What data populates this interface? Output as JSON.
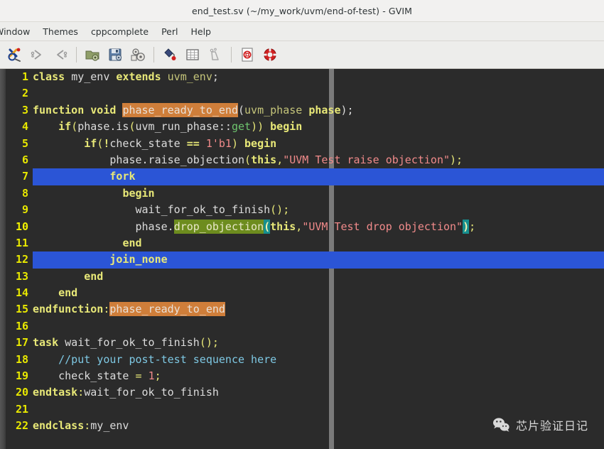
{
  "window": {
    "title": "end_test.sv (~/my_work/uvm/end-of-test) - GVIM"
  },
  "menubar": {
    "items": [
      {
        "label": "Window"
      },
      {
        "label": "Themes"
      },
      {
        "label": "cppcomplete"
      },
      {
        "label": "Perl"
      },
      {
        "label": "Help"
      }
    ]
  },
  "toolbar": {
    "buttons": [
      {
        "name": "gvim-logo-icon",
        "title": "GVim"
      },
      {
        "name": "redo-icon",
        "title": "Redo"
      },
      {
        "name": "undo-icon",
        "title": "Undo"
      },
      {
        "name": "open-folder-icon",
        "title": "Open"
      },
      {
        "name": "save-icon",
        "title": "Save"
      },
      {
        "name": "save-all-icon",
        "title": "Save All"
      },
      {
        "name": "paint-bucket-icon",
        "title": "Color"
      },
      {
        "name": "grid-table-icon",
        "title": "Table"
      },
      {
        "name": "tag-icon",
        "title": "Tags"
      },
      {
        "name": "help-page-icon",
        "title": "Help"
      },
      {
        "name": "lifebuoy-icon",
        "title": "Find Help"
      }
    ]
  },
  "editor": {
    "filename": "end_test.sv",
    "column_marker_column": 80,
    "colors": {
      "background": "#2b2b2b",
      "line_number": "#e8e800",
      "selection": "#2b55d6",
      "keyword": "#e8e878",
      "string": "#f08a8a",
      "comment": "#7ec8e3",
      "function": "#6ec46e",
      "match_highlight": "#cf7e3a",
      "search_highlight": "#6d8c1e",
      "paren_match": "#178f8f",
      "column_marker": "#7a7a7a"
    },
    "lines": [
      {
        "num": "1",
        "selected": false,
        "cursor": false,
        "tokens": [
          {
            "t": "class",
            "c": "kw"
          },
          {
            "t": " ",
            "c": "plain"
          },
          {
            "t": "my_env",
            "c": "id"
          },
          {
            "t": " ",
            "c": "plain"
          },
          {
            "t": "extends",
            "c": "kw"
          },
          {
            "t": " ",
            "c": "plain"
          },
          {
            "t": "uvm_env",
            "c": "typ"
          },
          {
            "t": ";",
            "c": "plain"
          }
        ]
      },
      {
        "num": "2",
        "selected": false,
        "cursor": false,
        "tokens": []
      },
      {
        "num": "3",
        "selected": false,
        "cursor": false,
        "tokens": [
          {
            "t": "function",
            "c": "kw"
          },
          {
            "t": " ",
            "c": "plain"
          },
          {
            "t": "void",
            "c": "kw"
          },
          {
            "t": " ",
            "c": "plain"
          },
          {
            "t": "phase_ready_to_end",
            "c": "hl-orange"
          },
          {
            "t": "(",
            "c": "plain"
          },
          {
            "t": "uvm_phase",
            "c": "typ"
          },
          {
            "t": " ",
            "c": "plain"
          },
          {
            "t": "phase",
            "c": "kw"
          },
          {
            "t": ");",
            "c": "plain"
          }
        ]
      },
      {
        "num": "4",
        "selected": false,
        "cursor": false,
        "tokens": [
          {
            "t": "    ",
            "c": "plain"
          },
          {
            "t": "if",
            "c": "kw"
          },
          {
            "t": "(",
            "c": "punct"
          },
          {
            "t": "phase.is",
            "c": "id"
          },
          {
            "t": "(",
            "c": "punct"
          },
          {
            "t": "uvm_run_phase::",
            "c": "id"
          },
          {
            "t": "get",
            "c": "fn"
          },
          {
            "t": "))",
            "c": "punct"
          },
          {
            "t": " ",
            "c": "plain"
          },
          {
            "t": "begin",
            "c": "kw"
          }
        ]
      },
      {
        "num": "5",
        "selected": false,
        "cursor": false,
        "tokens": [
          {
            "t": "        ",
            "c": "plain"
          },
          {
            "t": "if",
            "c": "kw"
          },
          {
            "t": "(",
            "c": "punct"
          },
          {
            "t": "!",
            "c": "kw"
          },
          {
            "t": "check_state",
            "c": "id"
          },
          {
            "t": " ",
            "c": "plain"
          },
          {
            "t": "==",
            "c": "kw"
          },
          {
            "t": " ",
            "c": "plain"
          },
          {
            "t": "1'b1",
            "c": "num"
          },
          {
            "t": ")",
            "c": "punct"
          },
          {
            "t": " ",
            "c": "plain"
          },
          {
            "t": "begin",
            "c": "kw"
          }
        ]
      },
      {
        "num": "6",
        "selected": false,
        "cursor": false,
        "tokens": [
          {
            "t": "            ",
            "c": "plain"
          },
          {
            "t": "phase.raise_objection",
            "c": "id"
          },
          {
            "t": "(",
            "c": "punct"
          },
          {
            "t": "this",
            "c": "kw"
          },
          {
            "t": ",",
            "c": "punct"
          },
          {
            "t": "\"UVM Test raise objection\"",
            "c": "str"
          },
          {
            "t": ");",
            "c": "punct"
          }
        ]
      },
      {
        "num": "7",
        "selected": true,
        "cursor": false,
        "tokens": [
          {
            "t": "            ",
            "c": "plain"
          },
          {
            "t": "fork",
            "c": "kw"
          }
        ]
      },
      {
        "num": "8",
        "selected": false,
        "cursor": false,
        "tokens": [
          {
            "t": "              ",
            "c": "plain"
          },
          {
            "t": "begin",
            "c": "kw"
          }
        ]
      },
      {
        "num": "9",
        "selected": false,
        "cursor": false,
        "tokens": [
          {
            "t": "                ",
            "c": "plain"
          },
          {
            "t": "wait_for_ok_to_finish",
            "c": "id"
          },
          {
            "t": "();",
            "c": "punct"
          }
        ]
      },
      {
        "num": "10",
        "selected": false,
        "cursor": true,
        "tokens": [
          {
            "t": "                ",
            "c": "plain"
          },
          {
            "t": "phase.",
            "c": "id"
          },
          {
            "t": "drop_objection",
            "c": "hl-green"
          },
          {
            "t": "(",
            "c": "hl-teal"
          },
          {
            "t": "this",
            "c": "kw"
          },
          {
            "t": ",",
            "c": "punct"
          },
          {
            "t": "\"UVM Test drop objection\"",
            "c": "str"
          },
          {
            "t": ")",
            "c": "hl-teal"
          },
          {
            "t": ";",
            "c": "punct"
          }
        ]
      },
      {
        "num": "11",
        "selected": false,
        "cursor": false,
        "tokens": [
          {
            "t": "              ",
            "c": "plain"
          },
          {
            "t": "end",
            "c": "kw"
          }
        ]
      },
      {
        "num": "12",
        "selected": true,
        "cursor": false,
        "tokens": [
          {
            "t": "            ",
            "c": "plain"
          },
          {
            "t": "join_none",
            "c": "kw"
          }
        ]
      },
      {
        "num": "13",
        "selected": false,
        "cursor": false,
        "tokens": [
          {
            "t": "        ",
            "c": "plain"
          },
          {
            "t": "end",
            "c": "kw"
          }
        ]
      },
      {
        "num": "14",
        "selected": false,
        "cursor": false,
        "tokens": [
          {
            "t": "    ",
            "c": "plain"
          },
          {
            "t": "end",
            "c": "kw"
          }
        ]
      },
      {
        "num": "15",
        "selected": false,
        "cursor": false,
        "tokens": [
          {
            "t": "endfunction",
            "c": "kw"
          },
          {
            "t": ":",
            "c": "punct"
          },
          {
            "t": "phase_ready_to_end",
            "c": "hl-orange"
          }
        ]
      },
      {
        "num": "16",
        "selected": false,
        "cursor": false,
        "tokens": []
      },
      {
        "num": "17",
        "selected": false,
        "cursor": false,
        "tokens": [
          {
            "t": "task",
            "c": "kw"
          },
          {
            "t": " ",
            "c": "plain"
          },
          {
            "t": "wait_for_ok_to_finish",
            "c": "id"
          },
          {
            "t": "();",
            "c": "punct"
          }
        ]
      },
      {
        "num": "18",
        "selected": false,
        "cursor": false,
        "tokens": [
          {
            "t": "    ",
            "c": "plain"
          },
          {
            "t": "//put your post-test sequence here",
            "c": "cmt"
          }
        ]
      },
      {
        "num": "19",
        "selected": false,
        "cursor": false,
        "tokens": [
          {
            "t": "    ",
            "c": "plain"
          },
          {
            "t": "check_state",
            "c": "id"
          },
          {
            "t": " ",
            "c": "plain"
          },
          {
            "t": "=",
            "c": "punct"
          },
          {
            "t": " ",
            "c": "plain"
          },
          {
            "t": "1",
            "c": "num"
          },
          {
            "t": ";",
            "c": "punct"
          }
        ]
      },
      {
        "num": "20",
        "selected": false,
        "cursor": false,
        "tokens": [
          {
            "t": "endtask",
            "c": "kw"
          },
          {
            "t": ":",
            "c": "punct"
          },
          {
            "t": "wait_for_ok_to_finish",
            "c": "id"
          }
        ]
      },
      {
        "num": "21",
        "selected": false,
        "cursor": false,
        "tokens": []
      },
      {
        "num": "22",
        "selected": false,
        "cursor": false,
        "tokens": [
          {
            "t": "endclass",
            "c": "kw"
          },
          {
            "t": ":",
            "c": "punct"
          },
          {
            "t": "my_env",
            "c": "id"
          }
        ]
      }
    ]
  },
  "watermark": {
    "icon": "wechat-icon",
    "text": "芯片验证日记"
  }
}
